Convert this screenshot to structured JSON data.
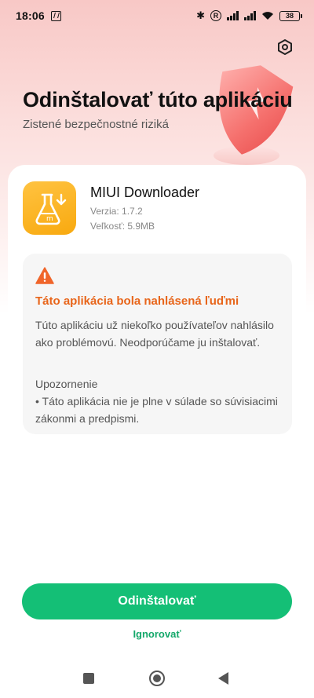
{
  "statusbar": {
    "time": "18:06",
    "battery": "38",
    "icons": [
      "nfc-icon",
      "bluetooth-icon",
      "roaming-icon",
      "signal-icon",
      "signal-icon",
      "wifi-icon",
      "battery-icon"
    ]
  },
  "header": {
    "title": "Odinštalovať túto aplikáciu",
    "subtitle": "Zistené bezpečnostné riziká",
    "settings_icon": "gear-icon"
  },
  "app": {
    "name": "MIUI Downloader",
    "version": "Verzia: 1.7.2",
    "size": "Veľkosť: 5.9MB",
    "icon": "flask-download-icon"
  },
  "warning": {
    "icon": "warning-triangle-icon",
    "title": "Táto aplikácia bola nahlásená ľuďmi",
    "text": "Túto aplikáciu už niekoľko používateľov nahlásilo ako problémovú. Neodporúčame ju inštalovať.",
    "note_title": "Upozornenie",
    "note_text": "• Táto aplikácia nie je plne v súlade so súvisiacimi zákonmi a predpismi."
  },
  "actions": {
    "uninstall_label": "Odinštalovať",
    "ignore_label": "Ignorovať"
  },
  "colors": {
    "accent": "#14bf76",
    "warning": "#e8651a",
    "app_icon": "#f8a90f"
  }
}
